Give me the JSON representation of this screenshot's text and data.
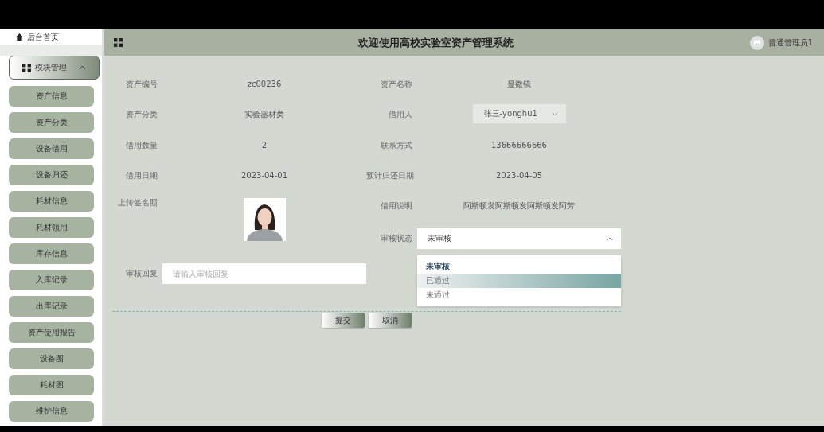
{
  "sidebar": {
    "home": "后台首页",
    "group": {
      "label": "模块管理",
      "expanded": true
    },
    "items": [
      "资产信息",
      "资产分类",
      "设备借用",
      "设备归还",
      "耗材信息",
      "耗材领用",
      "库存信息",
      "入库记录",
      "出库记录",
      "资产使用报告",
      "设备图",
      "耗材图",
      "维护信息"
    ]
  },
  "header": {
    "title": "欢迎使用高校实验室资产管理系统",
    "user": "普通管理员1"
  },
  "form": {
    "fields": [
      {
        "kind": "text",
        "label": "资产编号",
        "value": "zc00236"
      },
      {
        "kind": "text",
        "label": "资产名称",
        "value": "显微镜"
      },
      {
        "kind": "text",
        "label": "资产分类",
        "value": "实验器材类"
      },
      {
        "kind": "select",
        "label": "借用人",
        "value": "张三-yonghu1"
      },
      {
        "kind": "text",
        "label": "借用数量",
        "value": "2"
      },
      {
        "kind": "text",
        "label": "联系方式",
        "value": "13666666666"
      },
      {
        "kind": "text",
        "label": "借用日期",
        "value": "2023-04-01"
      },
      {
        "kind": "text",
        "label": "预计归还日期",
        "value": "2023-04-05"
      },
      {
        "label": "上传签名照"
      },
      {
        "kind": "text",
        "label": "借用说明",
        "value": "阿斯顿发阿斯顿发阿斯顿发阿芳"
      },
      {
        "kind": "status",
        "label": "审核状态",
        "value": "未审核",
        "expanded": true,
        "options": [
          {
            "label": "未审核",
            "selected": true,
            "hovered": false
          },
          {
            "label": "已通过",
            "selected": false,
            "hovered": true
          },
          {
            "label": "未通过",
            "selected": false,
            "hovered": false
          }
        ]
      },
      {
        "kind": "input",
        "label": "审核回复",
        "placeholder": "请输入审核回复"
      }
    ],
    "buttons": [
      "提交",
      "取消"
    ]
  }
}
